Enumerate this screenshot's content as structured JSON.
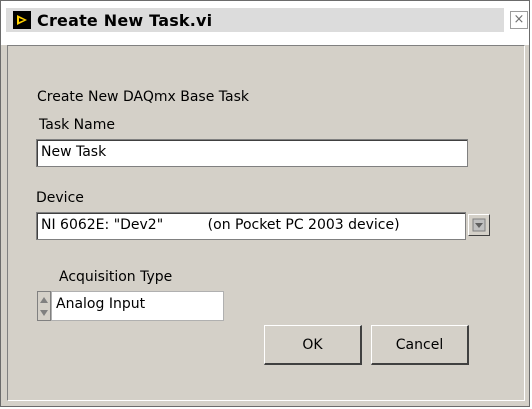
{
  "window": {
    "title": "Create New Task.vi",
    "close_glyph": "×"
  },
  "form": {
    "heading": "Create New DAQmx Base Task",
    "task_name_label": "Task Name",
    "task_name_value": "New Task",
    "device_label": "Device",
    "device_value": "NI 6062E: \"Dev2\"          (on Pocket PC 2003 device)",
    "acquisition_label": "Acquisition Type",
    "acquisition_value": "Analog Input"
  },
  "buttons": {
    "ok": "OK",
    "cancel": "Cancel"
  },
  "icons": {
    "app": "labview-vi-icon",
    "dropdown": "chevron-down-icon",
    "spinner": "increment-decrement-icon"
  }
}
